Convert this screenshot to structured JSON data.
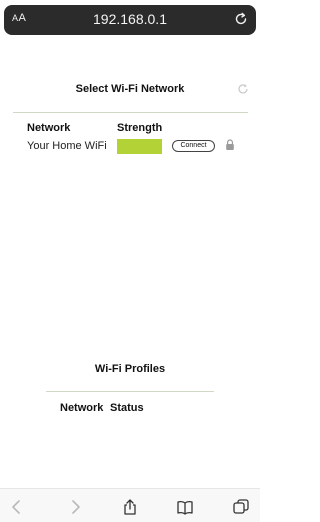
{
  "browser": {
    "aa_label": "AA",
    "url": "192.168.0.1"
  },
  "wifi_section": {
    "title": "Select Wi-Fi Network",
    "columns": {
      "network": "Network",
      "strength": "Strength"
    },
    "networks": [
      {
        "name": "Your Home WiFi",
        "strength_color": "#b2d235",
        "action": "Connect",
        "secured": true
      }
    ]
  },
  "profiles_section": {
    "title": "Wi-Fi Profiles",
    "columns": {
      "network": "Network",
      "status": "Status"
    }
  },
  "toolbar": {
    "icons": [
      "back-icon",
      "forward-icon",
      "share-icon",
      "bookmarks-icon",
      "tabs-icon"
    ]
  },
  "colors": {
    "url_bar": "#2b2b2b",
    "strength_bar": "#b2d235",
    "divider": "#cfd9c4"
  }
}
